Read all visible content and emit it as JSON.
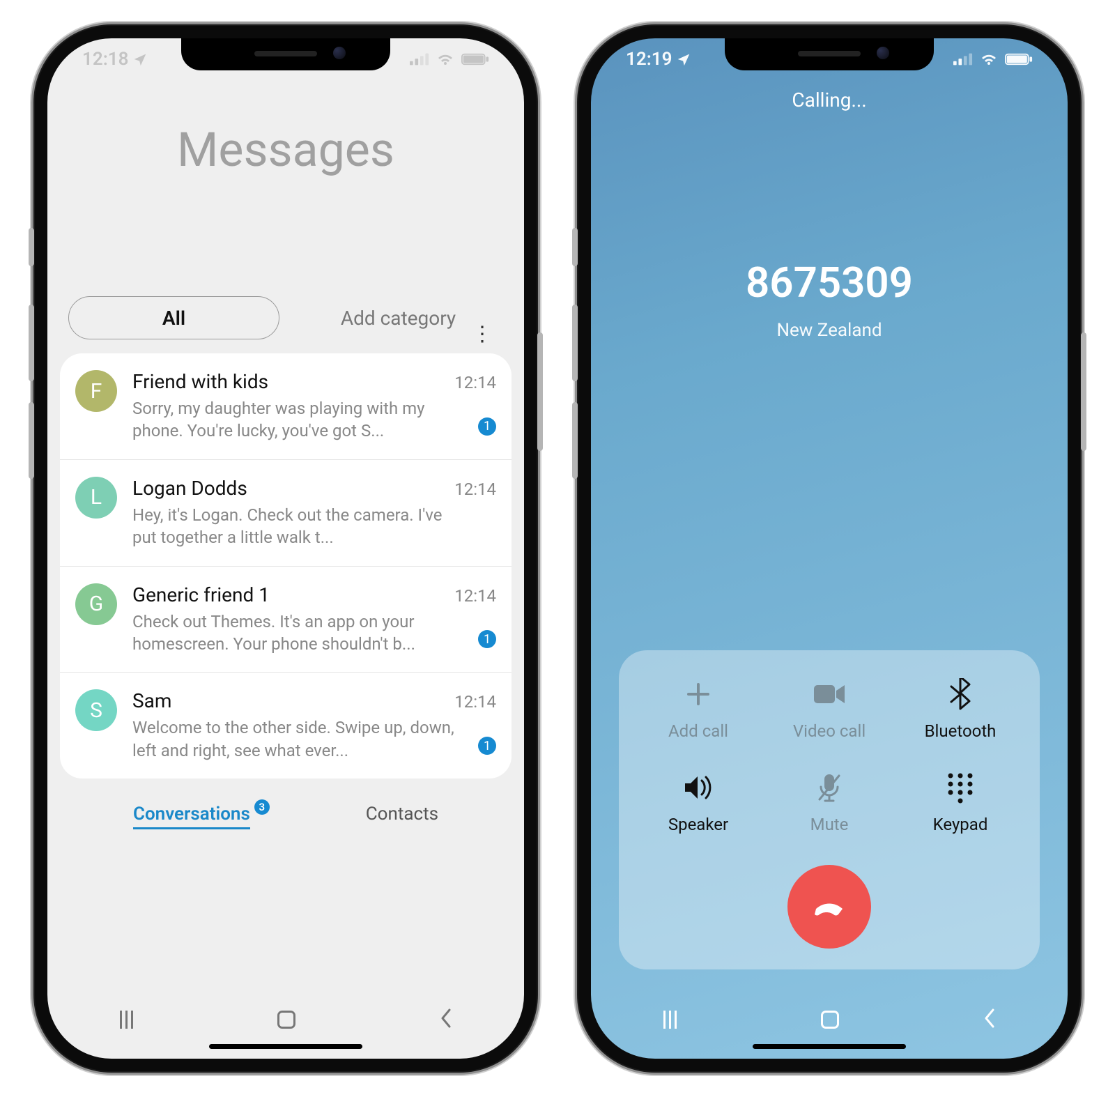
{
  "left": {
    "status": {
      "time": "12:18"
    },
    "header_title": "Messages",
    "filters": {
      "all": "All",
      "add_category": "Add category"
    },
    "conversations": [
      {
        "initial": "F",
        "avatar_color": "#b2b76a",
        "name": "Friend with kids",
        "time": "12:14",
        "preview": "Sorry, my daughter was playing with my phone. You're lucky, you've got S...",
        "unread": 1
      },
      {
        "initial": "L",
        "avatar_color": "#7ecfb4",
        "name": "Logan Dodds",
        "time": "12:14",
        "preview": "Hey, it's Logan. Check out the camera. I've put together a little walk t...",
        "unread": 0
      },
      {
        "initial": "G",
        "avatar_color": "#86c993",
        "name": "Generic friend 1",
        "time": "12:14",
        "preview": "Check out Themes. It's an app on your homescreen. Your phone shouldn't b...",
        "unread": 1
      },
      {
        "initial": "S",
        "avatar_color": "#74d6c4",
        "name": "Sam",
        "time": "12:14",
        "preview": "Welcome to the other side. Swipe up, down, left and right, see what ever...",
        "unread": 1
      }
    ],
    "tabs": {
      "conversations": "Conversations",
      "conversations_badge": 3,
      "contacts": "Contacts"
    }
  },
  "right": {
    "status": {
      "time": "12:19"
    },
    "calling_label": "Calling...",
    "number": "8675309",
    "region": "New Zealand",
    "panel": {
      "add_call": "Add call",
      "video_call": "Video call",
      "bluetooth": "Bluetooth",
      "speaker": "Speaker",
      "mute": "Mute",
      "keypad": "Keypad"
    }
  }
}
